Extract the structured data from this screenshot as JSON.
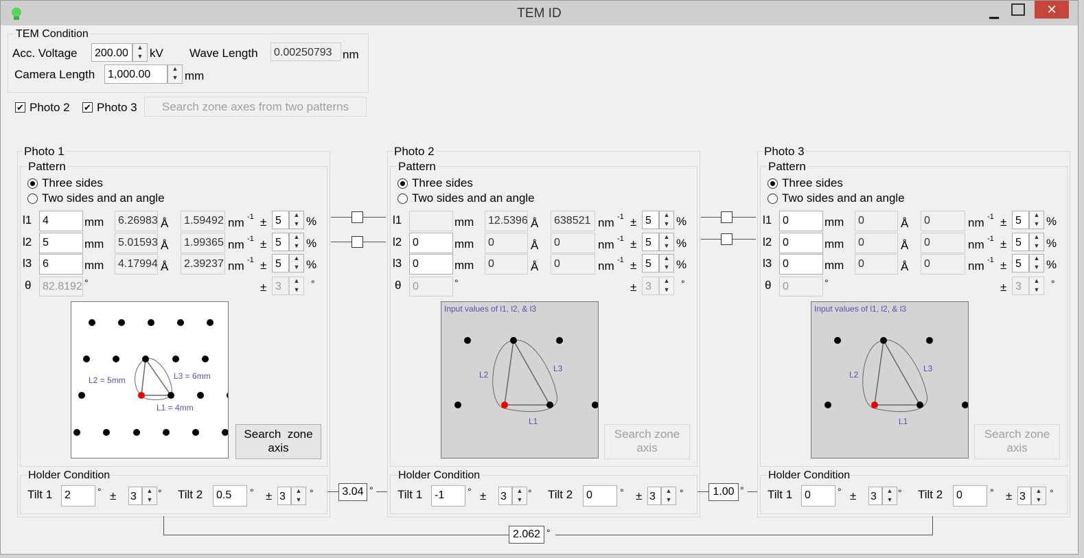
{
  "window": {
    "title": "TEM ID"
  },
  "tem_condition": {
    "group_label": "TEM Condition",
    "acc_voltage_label": "Acc. Voltage",
    "acc_voltage_value": "200.00",
    "acc_voltage_unit": "kV",
    "wave_length_label": "Wave Length",
    "wave_length_value": "0.00250793",
    "wave_length_unit": "nm",
    "camera_length_label": "Camera Length",
    "camera_length_value": "1,000.00",
    "camera_length_unit": "mm"
  },
  "options": {
    "photo2_label": "Photo 2",
    "photo3_label": "Photo 3",
    "search_two_label": "Search zone axes from two patterns"
  },
  "common": {
    "pattern_label": "Pattern",
    "three_sides": "Three sides",
    "two_sides_angle": "Two sides and an angle",
    "mm": "mm",
    "angstrom": "Å",
    "nm_inv": "nm",
    "inv_sup": "-1",
    "pm": "±",
    "pct": "%",
    "deg": "°",
    "theta": "θ",
    "l1": "l1",
    "l2": "l2",
    "l3": "l3",
    "holder_label": "Holder Condition",
    "tilt1": "Tilt 1",
    "tilt2": "Tilt 2",
    "search_zone_line1": "Search  zone",
    "search_zone_line2": "axis",
    "search_zone_line1_dis": "Search zone",
    "input_hint": "Input values of l1, l2, & l3"
  },
  "photo1": {
    "title": "Photo 1",
    "rows": [
      {
        "mm": "4",
        "ang": "6.26983",
        "nm": "1.59492",
        "tol": "5"
      },
      {
        "mm": "5",
        "ang": "5.01593",
        "nm": "1.99365",
        "tol": "5"
      },
      {
        "mm": "6",
        "ang": "4.17994",
        "nm": "2.39237",
        "tol": "5"
      }
    ],
    "theta": "82.8192",
    "theta_tol": "3",
    "tilt1": "2",
    "tilt1_tol": "3",
    "tilt2": "0.5",
    "tilt2_tol": "3",
    "diagram": {
      "L1": "L1 = 4mm",
      "L2": "L2 = 5mm",
      "L3": "L3 = 6mm"
    }
  },
  "photo2": {
    "title": "Photo 2",
    "rows": [
      {
        "mm": "",
        "ang": "12.5396",
        "nm": "638521",
        "tol": "5"
      },
      {
        "mm": "0",
        "ang": "0",
        "nm": "0",
        "tol": "5"
      },
      {
        "mm": "0",
        "ang": "0",
        "nm": "0",
        "tol": "5"
      }
    ],
    "theta": "0",
    "theta_tol": "3",
    "tilt1": "-1",
    "tilt1_tol": "3",
    "tilt2": "0",
    "tilt2_tol": "3",
    "diagram": {
      "L1": "L1",
      "L2": "L2",
      "L3": "L3"
    }
  },
  "photo3": {
    "title": "Photo 3",
    "rows": [
      {
        "mm": "0",
        "ang": "0",
        "nm": "0",
        "tol": "5"
      },
      {
        "mm": "0",
        "ang": "0",
        "nm": "0",
        "tol": "5"
      },
      {
        "mm": "0",
        "ang": "0",
        "nm": "0",
        "tol": "5"
      }
    ],
    "theta": "0",
    "theta_tol": "3",
    "tilt1": "0",
    "tilt1_tol": "3",
    "tilt2": "0",
    "tilt2_tol": "3",
    "diagram": {
      "L1": "L1",
      "L2": "L2",
      "L3": "L3"
    }
  },
  "connectors": {
    "angle_12": "3.04",
    "angle_23": "1.00",
    "angle_13": "2.062",
    "deg": "°"
  }
}
